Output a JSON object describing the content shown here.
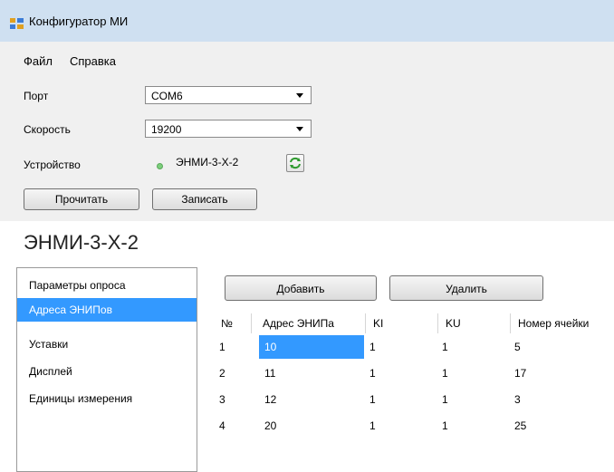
{
  "window": {
    "title": "Конфигуратор МИ",
    "app_icon": "windows-form-icon"
  },
  "menu": {
    "items": [
      "Файл",
      "Справка"
    ]
  },
  "form": {
    "port_label": "Порт",
    "port_value": "COM6",
    "speed_label": "Скорость",
    "speed_value": "19200",
    "device_label": "Устройство",
    "device_value": "ЭНМИ-3-Х-2",
    "device_status_color": "#7ccf7c",
    "refresh_icon": "refresh-icon",
    "read_button": "Прочитать",
    "write_button": "Записать"
  },
  "device_title": "ЭНМИ-3-Х-2",
  "sidebar": {
    "items": [
      "Параметры опроса",
      "Адреса ЭНИПов",
      "Уставки",
      "Дисплей",
      "Единицы измерения"
    ],
    "selected_index": 1
  },
  "grid": {
    "add_button": "Добавить",
    "delete_button": "Удалить",
    "headers": [
      "№",
      "Адрес ЭНИПа",
      "KI",
      "KU",
      "Номер ячейки"
    ],
    "rows": [
      [
        "1",
        "10",
        "1",
        "1",
        "5"
      ],
      [
        "2",
        "11",
        "1",
        "1",
        "17"
      ],
      [
        "3",
        "12",
        "1",
        "1",
        "3"
      ],
      [
        "4",
        "20",
        "1",
        "1",
        "25"
      ]
    ]
  },
  "colors": {
    "selection": "#3399ff",
    "titlebar": "#cfe0f1",
    "form_bg": "#f0f0f0"
  }
}
